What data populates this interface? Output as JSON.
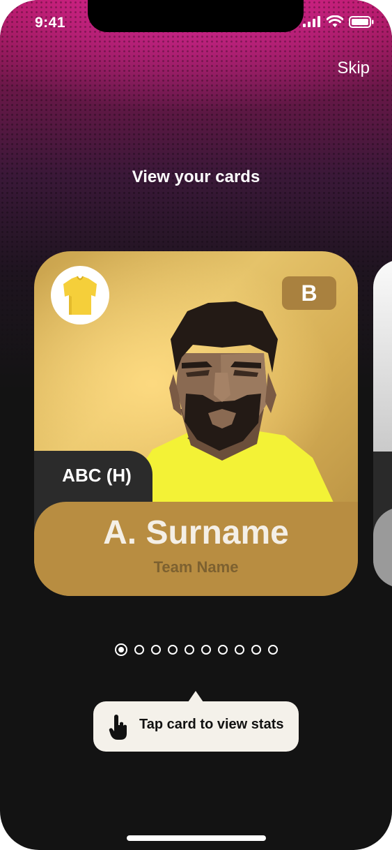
{
  "status_bar": {
    "time": "9:41",
    "icons": [
      "signal-icon",
      "wifi-icon",
      "battery-icon"
    ]
  },
  "header": {
    "skip_label": "Skip",
    "title": "View your cards"
  },
  "card": {
    "kit_icon": "jersey-icon",
    "kit_color": "#f5cf3a",
    "rating": "B",
    "position": "ABC (H)",
    "player_name": "A. Surname",
    "team_name": "Team Name",
    "accent_gold": "#b88d41"
  },
  "pager": {
    "total": 10,
    "active_index": 0
  },
  "tooltip": {
    "icon": "tap-hand-icon",
    "text": "Tap card to view stats"
  },
  "colors": {
    "background": "#131313",
    "top_gradient": "#b3165e"
  }
}
